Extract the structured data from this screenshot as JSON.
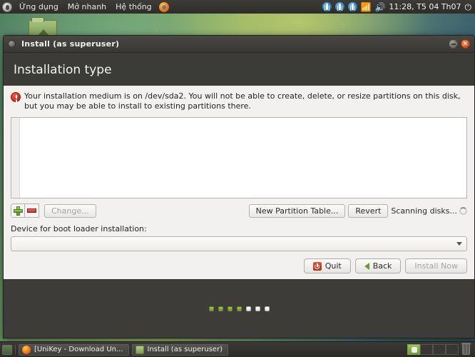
{
  "top_panel": {
    "menus": [
      "Ứng dụng",
      "Mở nhanh",
      "Hệ thống"
    ],
    "firefox_icon": "firefox-icon",
    "gnome_icon": "gnome-foot-icon",
    "accessibility_icons": [
      "accessibility-icon",
      "accessibility-icon",
      "accessibility-icon"
    ],
    "wifi_icon": "wifi-icon",
    "volume_icon": "volume-icon",
    "clock": "11:28, T5 04 Th07",
    "power_icon": "power-icon"
  },
  "desktop": {
    "home_folder_icon": "home-folder-icon"
  },
  "window": {
    "title": "Install (as superuser)",
    "minimize_label": "minimize-icon",
    "close_label": "close-icon",
    "page_title": "Installation type"
  },
  "warning": {
    "icon": "error-icon",
    "text": "Your installation medium is on /dev/sda2. You will not be able to create, delete, or resize partitions on this disk, but you may be able to install to existing partitions there."
  },
  "partition_table": {
    "rows": [],
    "empty": true
  },
  "tools": {
    "add_icon": "plus-icon",
    "remove_icon": "minus-icon",
    "change_label": "Change...",
    "new_partition_table_label": "New Partition Table...",
    "revert_label": "Revert",
    "status_text": "Scanning disks...",
    "spinner_icon": "spinner-icon"
  },
  "boot_loader": {
    "label": "Device for boot loader installation:",
    "selected_value": "",
    "caret_icon": "chevron-down-icon"
  },
  "actions": {
    "quit_label": "Quit",
    "quit_icon": "power-quit-icon",
    "back_label": "Back",
    "back_icon": "chevron-left-icon",
    "install_label": "Install Now"
  },
  "progress_dots": {
    "total": 7,
    "completed": 4,
    "states": [
      "on",
      "on",
      "on",
      "on",
      "off",
      "off",
      "off"
    ]
  },
  "taskbar": {
    "show_desktop_icon": "show-desktop-icon",
    "windows": [
      {
        "icon": "firefox-icon",
        "label": "[UniKey - Download Un..."
      },
      {
        "icon": "installer-icon",
        "label": "Install (as superuser)"
      }
    ],
    "workspaces": [
      {
        "active": true
      },
      {
        "active": false
      },
      {
        "active": false
      },
      {
        "active": false
      }
    ],
    "trash_icon": "trash-icon"
  }
}
